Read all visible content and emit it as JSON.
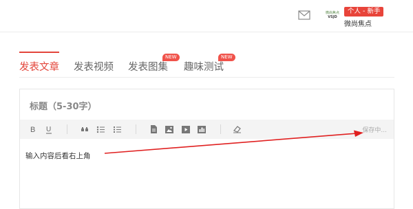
{
  "header": {
    "avatar_text_top": "微尚焦点",
    "avatar_text_bottom": "VSJD",
    "user_level": "个人 - 新手",
    "user_name": "微尚焦点"
  },
  "tabs": [
    {
      "label": "发表文章",
      "active": true,
      "new": false
    },
    {
      "label": "发表视频",
      "active": false,
      "new": false
    },
    {
      "label": "发表图集",
      "active": false,
      "new": true
    },
    {
      "label": "趣味测试",
      "active": false,
      "new": true
    }
  ],
  "new_badge_label": "NEW",
  "editor": {
    "title_placeholder": "标题（5-30字）",
    "save_status": "保存中...",
    "body_text": "输入内容后看右上角"
  },
  "icons": [
    "mail-icon",
    "bold-icon",
    "underline-icon",
    "quote-icon",
    "bullet-list-icon",
    "numbered-list-icon",
    "document-icon",
    "image-icon",
    "video-icon",
    "chart-icon",
    "eraser-icon"
  ],
  "colors": {
    "accent": "#e3453a",
    "annotation_arrow": "#e02020"
  }
}
